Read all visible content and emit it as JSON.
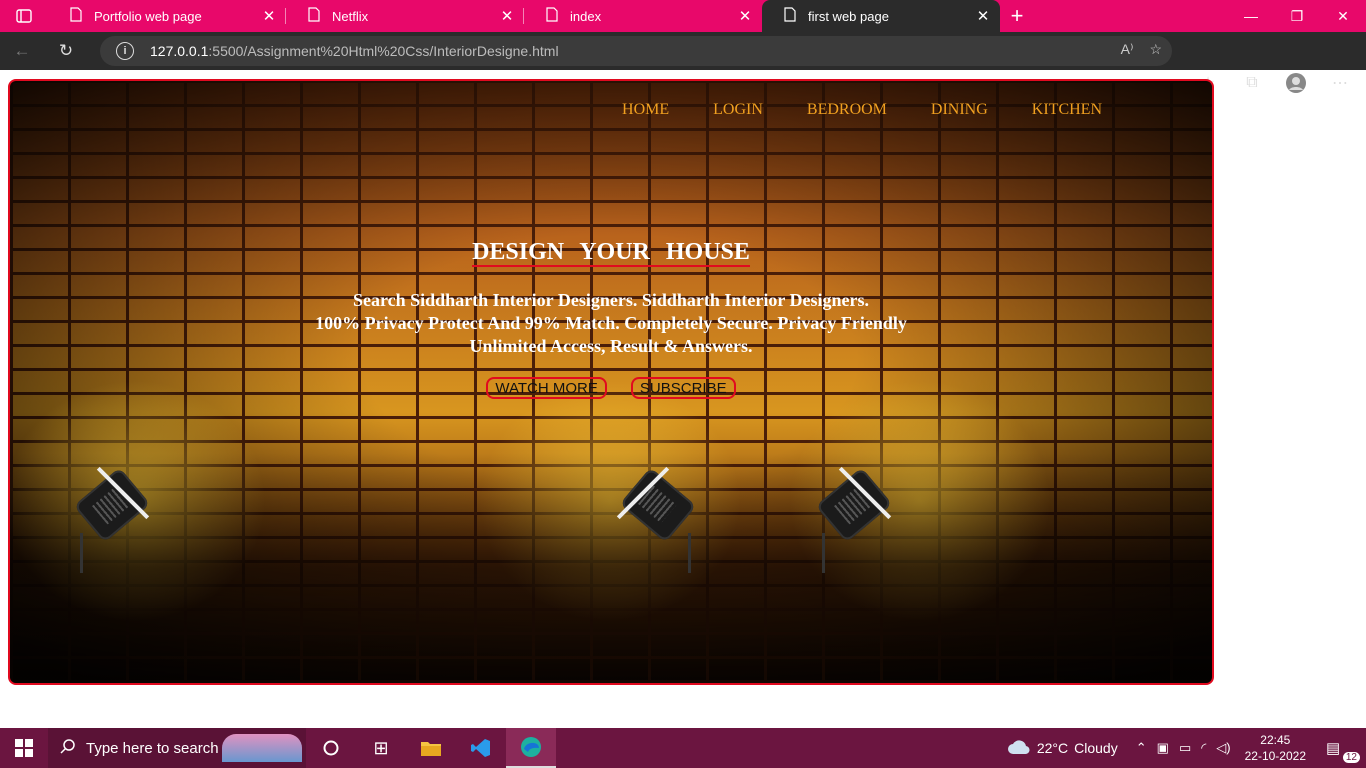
{
  "browser": {
    "tabs": [
      {
        "title": "Portfolio web page",
        "active": false
      },
      {
        "title": "Netflix",
        "active": false
      },
      {
        "title": "index",
        "active": false
      },
      {
        "title": "first web page",
        "active": true
      }
    ],
    "url_host": "127.0.0.1",
    "url_path": ":5500/Assignment%20Html%20Css/InteriorDesigne.html"
  },
  "site": {
    "nav": [
      "HOME",
      "LOGIN",
      "BEDROOM",
      "DINING",
      "KITCHEN"
    ],
    "headline": "DESIGN YOUR HOUSE",
    "tagline": [
      "Search Siddharth Interior Designers. Siddharth Interior Designers.",
      "100% Privacy Protect And 99% Match. Completely Secure. Privacy Friendly",
      "Unlimited Access, Result & Answers."
    ],
    "buttons": {
      "watch_more": "WATCH MORE",
      "subscribe": "SUBSCRIBE"
    }
  },
  "taskbar": {
    "search_placeholder": "Type here to search",
    "weather": {
      "temp": "22°C",
      "condition": "Cloudy"
    },
    "time": "22:45",
    "date": "22-10-2022",
    "notification_count": "12"
  },
  "colors": {
    "browser_frame": "#e8086a",
    "hero_border": "#e10a1f",
    "nav_link": "#f0a020",
    "taskbar": "#6b1540"
  }
}
